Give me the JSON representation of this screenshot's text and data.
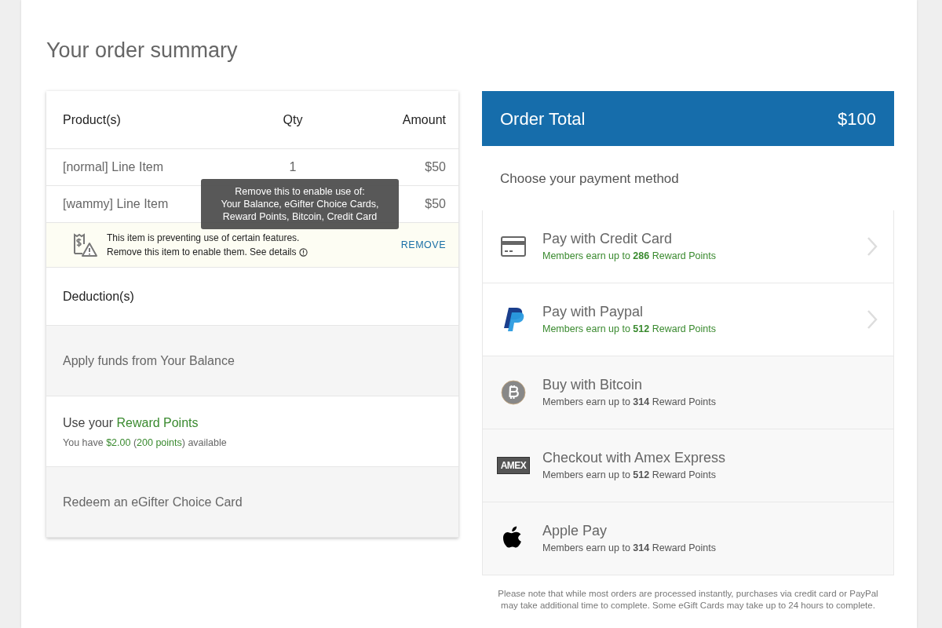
{
  "title": "Your order summary",
  "products": {
    "columns": [
      "Product(s)",
      "Qty",
      "Amount"
    ],
    "rows": [
      {
        "name": "[normal] Line Item",
        "qty": "1",
        "amount": "$50"
      },
      {
        "name": "[wammy] Line Item",
        "amount": "$50"
      }
    ]
  },
  "warning": {
    "line1": "This item is preventing use of certain features.",
    "line2": "Remove this item to enable them. See details",
    "action": "REMOVE"
  },
  "tooltip": {
    "title": "Remove this to enable use of:",
    "body": "Your Balance, eGifter Choice Cards, Reward Points, Bitcoin, Credit Card"
  },
  "deductions": {
    "heading": "Deduction(s)",
    "items": [
      {
        "kind": "plain",
        "label": "Apply funds from Your Balance",
        "disabled": true
      },
      {
        "kind": "points",
        "label": "Use your ",
        "highlight": "Reward Points",
        "disabled": false,
        "detail": [
          {
            "text": "You have ",
            "accent": false
          },
          {
            "text": "$2.00",
            "accent": true
          },
          {
            "text": " (",
            "accent": false
          },
          {
            "text": "200 points",
            "accent": true
          },
          {
            "text": ") available",
            "accent": false
          }
        ]
      },
      {
        "kind": "plain",
        "label": "Redeem an eGifter Choice Card",
        "disabled": true
      }
    ]
  },
  "order_total": {
    "label": "Order Total",
    "amount": "$100"
  },
  "payment_prompt": "Choose your payment method",
  "payment_methods": [
    {
      "kind": "card",
      "label": "Pay with Credit Card",
      "reward": "Members earn up to **286** Reward Points",
      "disabled": false
    },
    {
      "kind": "paypal",
      "label": "Pay with Paypal",
      "reward": "Members earn up to **512** Reward Points",
      "disabled": false
    },
    {
      "kind": "bitcoin",
      "label": "Buy with Bitcoin",
      "reward": "Members earn up to **314** Reward Points",
      "disabled": true
    },
    {
      "kind": "amex",
      "label": "Checkout with Amex Express",
      "reward": "Members earn up to **512** Reward Points",
      "disabled": true,
      "logo_text": "AMEX"
    },
    {
      "kind": "apple",
      "label": "Apple Pay",
      "reward": "Members earn up to **314** Reward Points",
      "disabled": true
    }
  ],
  "note": "Please note that while most orders are processed instantly, purchases via credit card or PayPal may take additional time to complete. Some eGift Cards may take up to 24 hours to complete."
}
